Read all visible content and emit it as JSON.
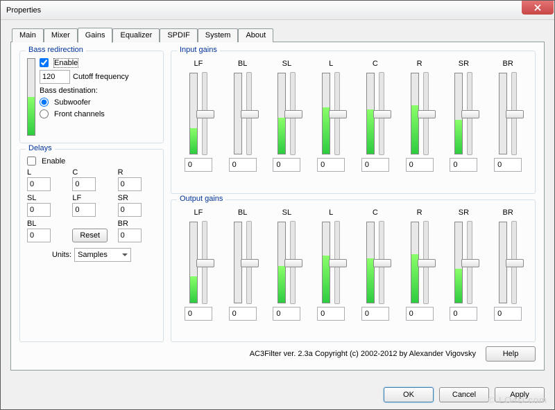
{
  "window": {
    "title": "Properties"
  },
  "tabs": [
    "Main",
    "Mixer",
    "Gains",
    "Equalizer",
    "SPDIF",
    "System",
    "About"
  ],
  "active_tab": "Gains",
  "bass": {
    "legend": "Bass redirection",
    "enable_label": "Enable",
    "enable_checked": true,
    "cutoff_value": "120",
    "cutoff_label": "Cutoff frequency",
    "dest_label": "Bass destination:",
    "dest_options": {
      "subwoofer": "Subwoofer",
      "front": "Front channels"
    },
    "dest_selected": "subwoofer",
    "meter_fill_pct": 50
  },
  "delays": {
    "legend": "Delays",
    "enable_label": "Enable",
    "enable_checked": false,
    "cells": [
      {
        "label": "L",
        "value": "0"
      },
      {
        "label": "C",
        "value": "0"
      },
      {
        "label": "R",
        "value": "0"
      },
      {
        "label": "SL",
        "value": "0"
      },
      {
        "label": "LF",
        "value": "0"
      },
      {
        "label": "SR",
        "value": "0"
      },
      {
        "label": "BL",
        "value": "0"
      },
      {
        "label": "",
        "value": "",
        "reset": true,
        "reset_label": "Reset"
      },
      {
        "label": "BR",
        "value": "0"
      }
    ],
    "units_label": "Units:",
    "units_value": "Samples"
  },
  "input_gains": {
    "legend": "Input gains",
    "channels": [
      {
        "name": "LF",
        "value": "0",
        "meter": 32,
        "thumb": 54
      },
      {
        "name": "BL",
        "value": "0",
        "meter": 0,
        "thumb": 54
      },
      {
        "name": "SL",
        "value": "0",
        "meter": 45,
        "thumb": 54
      },
      {
        "name": "L",
        "value": "0",
        "meter": 58,
        "thumb": 54
      },
      {
        "name": "C",
        "value": "0",
        "meter": 55,
        "thumb": 54
      },
      {
        "name": "R",
        "value": "0",
        "meter": 60,
        "thumb": 54
      },
      {
        "name": "SR",
        "value": "0",
        "meter": 42,
        "thumb": 54
      },
      {
        "name": "BR",
        "value": "0",
        "meter": 0,
        "thumb": 54
      }
    ]
  },
  "output_gains": {
    "legend": "Output gains",
    "channels": [
      {
        "name": "LF",
        "value": "0",
        "meter": 32,
        "thumb": 54
      },
      {
        "name": "BL",
        "value": "0",
        "meter": 0,
        "thumb": 54
      },
      {
        "name": "SL",
        "value": "0",
        "meter": 45,
        "thumb": 54
      },
      {
        "name": "L",
        "value": "0",
        "meter": 58,
        "thumb": 54
      },
      {
        "name": "C",
        "value": "0",
        "meter": 55,
        "thumb": 54
      },
      {
        "name": "R",
        "value": "0",
        "meter": 60,
        "thumb": 54
      },
      {
        "name": "SR",
        "value": "0",
        "meter": 42,
        "thumb": 54
      },
      {
        "name": "BR",
        "value": "0",
        "meter": 0,
        "thumb": 54
      }
    ]
  },
  "footer": {
    "copyright": "AC3Filter ver. 2.3a Copyright (c) 2002-2012 by Alexander Vigovsky",
    "help_label": "Help"
  },
  "buttons": {
    "ok": "OK",
    "cancel": "Cancel",
    "apply": "Apply"
  },
  "watermark": "© LO4D.com"
}
